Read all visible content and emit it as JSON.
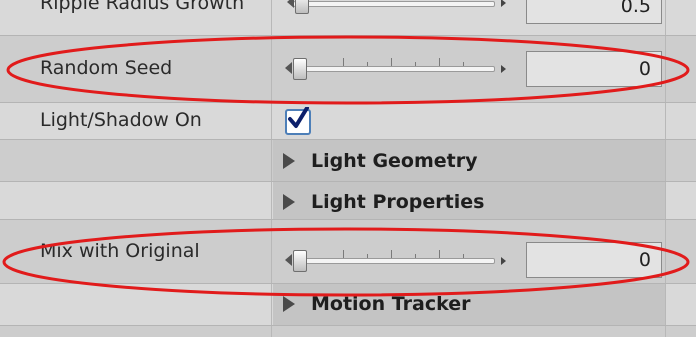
{
  "rows": {
    "ripple": {
      "label": "Ripple Radius Growth",
      "value": "0.5"
    },
    "random_seed": {
      "label": "Random Seed",
      "value": "0"
    },
    "light_shadow": {
      "label": "Light/Shadow On",
      "checked": true
    },
    "light_geometry": {
      "title": "Light Geometry"
    },
    "light_properties": {
      "title": "Light Properties"
    },
    "mix_original": {
      "label": "Mix with Original",
      "value": "0"
    },
    "motion_tracker": {
      "title": "Motion Tracker"
    }
  },
  "icons": {
    "disclosure": "disclosure-triangle-icon",
    "checkmark": "checkmark-icon",
    "stepper": "stepper-right-icon"
  },
  "colors": {
    "annotation": "#e11b1b",
    "checkbox_border": "#4d7fb8",
    "checkmark": "#0c1f6b"
  }
}
